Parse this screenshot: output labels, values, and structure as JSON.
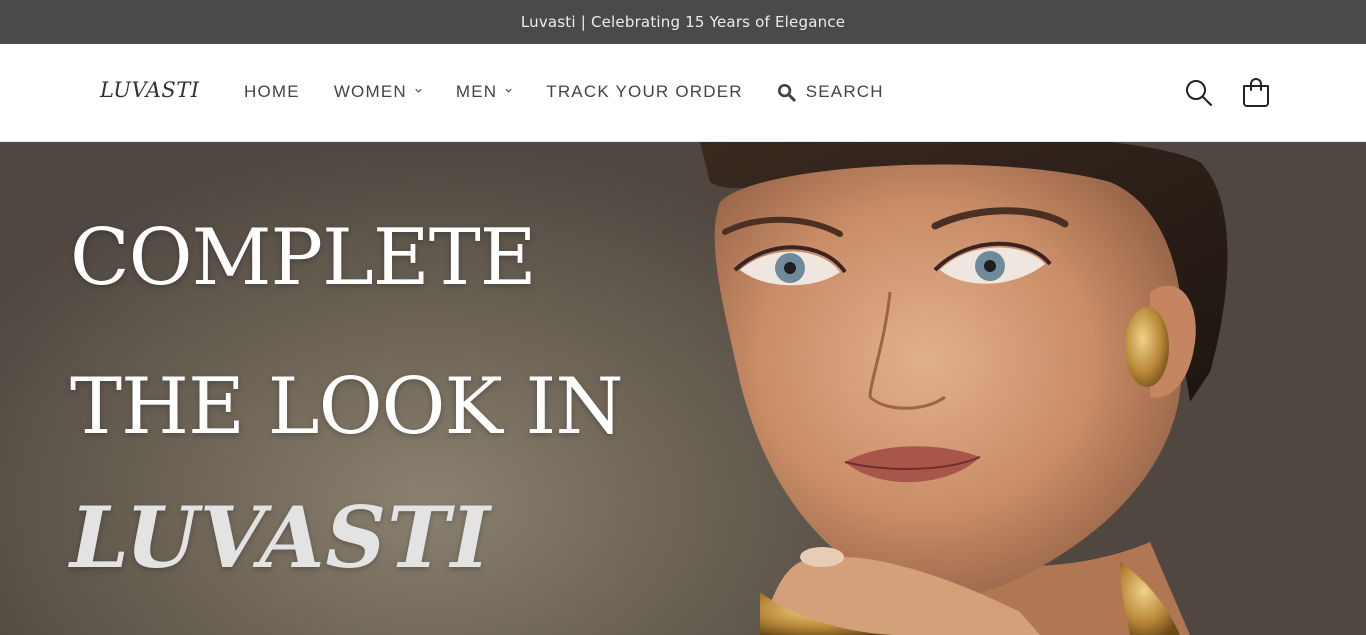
{
  "announcement": {
    "text": "Luvasti | Celebrating 15 Years of Elegance"
  },
  "header": {
    "logo": "LUVASTI",
    "nav": [
      {
        "label": "HOME",
        "has_dropdown": false
      },
      {
        "label": "WOMEN",
        "has_dropdown": true
      },
      {
        "label": "MEN",
        "has_dropdown": true
      },
      {
        "label": "TRACK YOUR ORDER",
        "has_dropdown": false
      }
    ],
    "search_label": "SEARCH",
    "icons": {
      "search": "search-icon",
      "cart": "cart-icon"
    }
  },
  "hero": {
    "line1": "COMPLETE",
    "line2": "THE LOOK IN",
    "brand": "LUVASTI"
  },
  "colors": {
    "announcement_bg": "#4a4a4a",
    "text_dark": "#444444",
    "hero_bg": "#6f6658"
  }
}
